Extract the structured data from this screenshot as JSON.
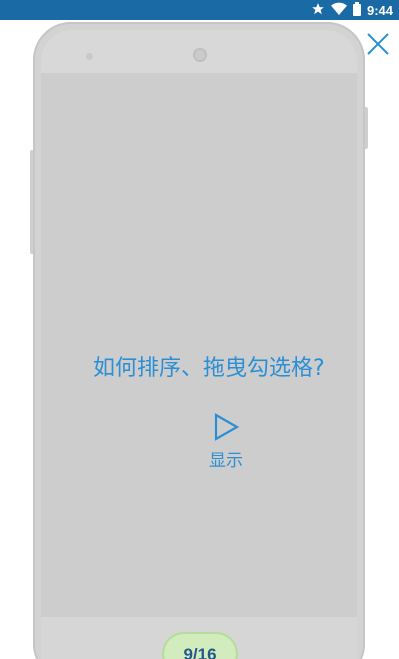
{
  "status_bar": {
    "time": "9:44",
    "icons": [
      "star-icon",
      "wifi-icon",
      "battery-icon"
    ],
    "background_color": "#1a6aa5"
  },
  "tutorial": {
    "question": "如何排序、拖曳勾选格?",
    "show_label": "显示",
    "accent_color": "#2b8fd4"
  },
  "pager": {
    "label": "9/16"
  },
  "close_icon": "close-icon"
}
